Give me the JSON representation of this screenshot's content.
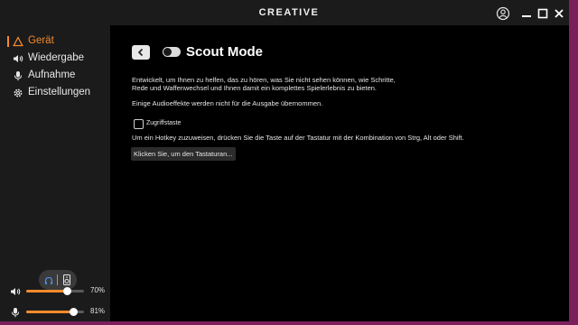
{
  "titlebar": {
    "brand": "CREATIVE"
  },
  "sidebar": {
    "items": [
      {
        "label": "Gerät",
        "icon": "warning-triangle-icon",
        "active": true
      },
      {
        "label": "Wiedergabe",
        "icon": "speaker-icon",
        "active": false
      },
      {
        "label": "Aufnahme",
        "icon": "microphone-icon",
        "active": false
      },
      {
        "label": "Einstellungen",
        "icon": "gear-icon",
        "active": false
      }
    ],
    "device_switch": {
      "left_icon": "headphones-icon",
      "right_icon": "speaker-device-icon"
    },
    "volume": {
      "icon": "speaker-volume-icon",
      "value": 70,
      "label": "70%"
    },
    "mic": {
      "icon": "microphone-icon",
      "value": 81,
      "label": "81%"
    }
  },
  "main": {
    "title": "Scout Mode",
    "toggle_on": false,
    "description_line1": "Entwickelt, um Ihnen zu helfen, das zu hören, was Sie nicht sehen können, wie Schritte,",
    "description_line2": "Rede und Waffenwechsel und Ihnen damit ein komplettes Spielerlebnis zu bieten.",
    "note": "Einige Audioeffekte werden nicht für die Ausgabe übernommen.",
    "checkbox_label": "Zugriffstaste",
    "checkbox_checked": false,
    "hotkey_instruction": "Um ein Hotkey zuzuweisen, drücken Sie die Taste auf der Tastatur mit der Kombination von Strg, Alt oder Shift.",
    "hotkey_button": "Klicken Sie, um den Tastaturan..."
  },
  "colors": {
    "accent": "#f28a2e",
    "background": "#000000",
    "sidebar": "#1b1b1b"
  }
}
